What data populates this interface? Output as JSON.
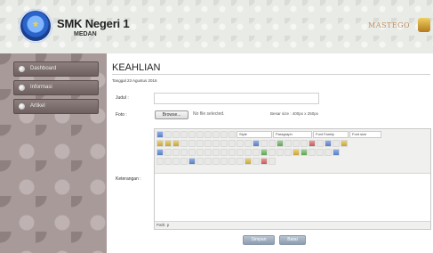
{
  "header": {
    "school_name": "SMK Negeri 1",
    "school_city": "MEDAN",
    "brand_text": "MASTEGO"
  },
  "sidebar": {
    "items": [
      {
        "label": "Dashboard"
      },
      {
        "label": "Informasi"
      },
      {
        "label": "Artikel"
      }
    ]
  },
  "main": {
    "page_title": "KEAHLIAN",
    "date_line": "Tanggal 23 Agustus 2016",
    "fields": {
      "judul_label": "Judul :",
      "judul_value": "",
      "foto_label": "Foto :",
      "browse_label": "Browse...",
      "file_status": "No file selected.",
      "size_hint": "Besar size : 400px x 250px",
      "keterangan_label": "Keterangan :"
    },
    "editor": {
      "style_select": "Style",
      "format_select": "Paragraph",
      "font_select": "Font Family",
      "size_select": "Font size",
      "status_path": "Path: p"
    },
    "buttons": {
      "simpan": "Simpan",
      "batal": "Batal"
    }
  }
}
